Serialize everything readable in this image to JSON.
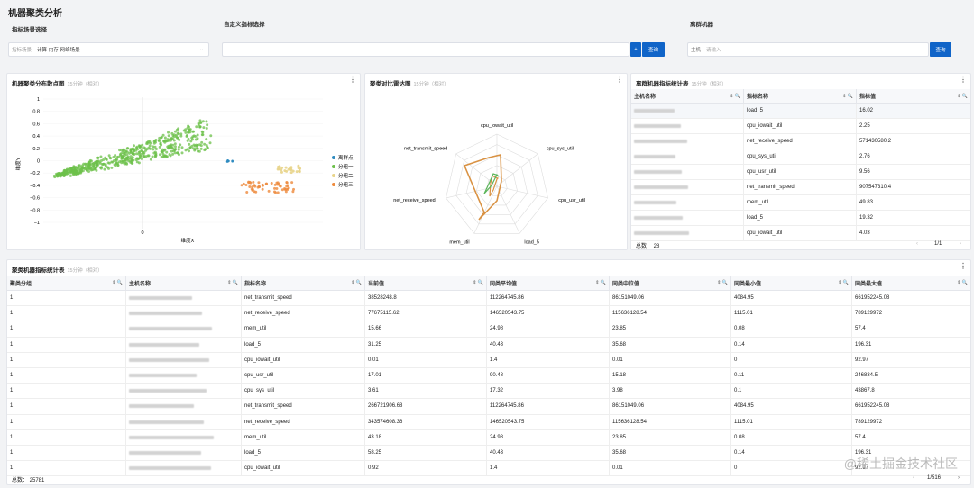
{
  "page": {
    "title": "机器聚类分析"
  },
  "filters": {
    "scene_label": "指标场景选择",
    "scene_prefix": "指标场景",
    "scene_value": "计算-内存-网络场景",
    "metric_label": "自定义指标选择",
    "metric_query": "查询",
    "plus": "+",
    "outlier_label": "离群机器",
    "host_prefix": "主机",
    "host_placeholder": "请输入",
    "host_query": "查询"
  },
  "scatter": {
    "title": "机器聚类分布散点图",
    "subtitle": "15分钟（相对）",
    "ylabel": "维度Y",
    "xlabel": "维度X",
    "yticks": [
      "1",
      "0.8",
      "0.6",
      "0.4",
      "0.2",
      "0",
      "−0.2",
      "−0.4",
      "−0.6",
      "−0.8",
      "−1"
    ],
    "xtick": "0",
    "legend": [
      {
        "name": "离群点",
        "color": "#2e8bc0"
      },
      {
        "name": "分组一",
        "color": "#6cc04a"
      },
      {
        "name": "分组二",
        "color": "#e8d48a"
      },
      {
        "name": "分组三",
        "color": "#ee8a3c"
      }
    ]
  },
  "radar": {
    "title": "聚类对比雷达图",
    "subtitle": "15分钟（相对）",
    "axes": [
      "cpu_iowait_util",
      "cpu_sys_util",
      "cpu_usr_util",
      "load_5",
      "mem_util",
      "net_receive_speed",
      "net_transmit_speed"
    ]
  },
  "outlier_table": {
    "title": "离群机器指标统计表",
    "subtitle": "15分钟（相对）",
    "headers": [
      "主机名称",
      "指标名称",
      "指标值"
    ],
    "rows": [
      {
        "metric": "load_5",
        "value": "16.02"
      },
      {
        "metric": "cpu_iowait_util",
        "value": "2.25"
      },
      {
        "metric": "net_receive_speed",
        "value": "571430580.2"
      },
      {
        "metric": "cpu_sys_util",
        "value": "2.76"
      },
      {
        "metric": "cpu_usr_util",
        "value": "9.56"
      },
      {
        "metric": "net_transmit_speed",
        "value": "907547310.4"
      },
      {
        "metric": "mem_util",
        "value": "49.83"
      },
      {
        "metric": "load_5",
        "value": "19.32"
      },
      {
        "metric": "cpu_iowait_util",
        "value": "4.03"
      }
    ],
    "total": "总数： 28",
    "pager": "1/1"
  },
  "cluster_table": {
    "title": "聚类机器指标统计表",
    "subtitle": "15分钟（相对）",
    "headers": [
      "聚类分组",
      "主机名称",
      "指标名称",
      "当前值",
      "同类平均值",
      "同类中位值",
      "同类最小值",
      "同类最大值"
    ],
    "rows": [
      [
        "1",
        "",
        "net_transmit_speed",
        "38528248.8",
        "112264745.86",
        "86151049.06",
        "4084.95",
        "661952245.08"
      ],
      [
        "1",
        "",
        "net_receive_speed",
        "77675115.62",
        "146520543.75",
        "115636128.54",
        "1115.01",
        "789129972"
      ],
      [
        "1",
        "",
        "mem_util",
        "15.66",
        "24.98",
        "23.85",
        "0.08",
        "57.4"
      ],
      [
        "1",
        "",
        "load_5",
        "31.25",
        "40.43",
        "35.68",
        "0.14",
        "196.31"
      ],
      [
        "1",
        "",
        "cpu_iowait_util",
        "0.01",
        "1.4",
        "0.01",
        "0",
        "92.97"
      ],
      [
        "1",
        "",
        "cpu_usr_util",
        "17.01",
        "90.48",
        "15.18",
        "0.11",
        "246834.5"
      ],
      [
        "1",
        "",
        "cpu_sys_util",
        "3.61",
        "17.32",
        "3.98",
        "0.1",
        "43867.8"
      ],
      [
        "1",
        "",
        "net_transmit_speed",
        "266721906.68",
        "112264745.86",
        "86151049.06",
        "4084.95",
        "661952245.08"
      ],
      [
        "1",
        "",
        "net_receive_speed",
        "343574608.36",
        "146520543.75",
        "115636128.54",
        "1115.01",
        "789129972"
      ],
      [
        "1",
        "",
        "mem_util",
        "43.18",
        "24.98",
        "23.85",
        "0.08",
        "57.4"
      ],
      [
        "1",
        "",
        "load_5",
        "58.25",
        "40.43",
        "35.68",
        "0.14",
        "196.31"
      ],
      [
        "1",
        "",
        "cpu_iowait_util",
        "0.92",
        "1.4",
        "0.01",
        "0",
        "92.97"
      ]
    ],
    "total": "总数： 25781",
    "pager": "1/516"
  },
  "watermark": "@稀土掘金技术社区"
}
